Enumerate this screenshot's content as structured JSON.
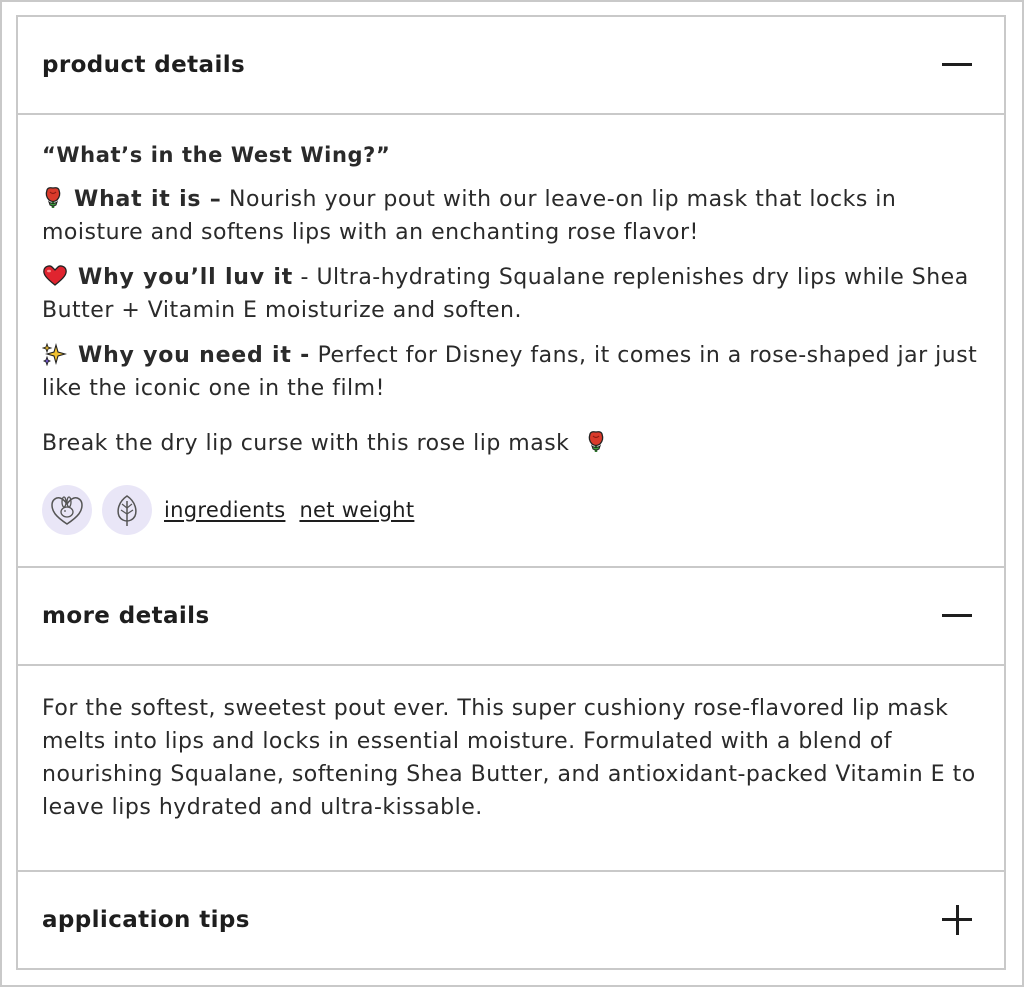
{
  "sections": [
    {
      "title": "product details",
      "expanded": true,
      "toggle_icon": "minus-icon"
    },
    {
      "title": "more details",
      "expanded": true,
      "toggle_icon": "minus-icon"
    },
    {
      "title": "application tips",
      "expanded": false,
      "toggle_icon": "plus-icon"
    }
  ],
  "product_details": {
    "quote": "“What’s in the West Wing?”",
    "what_it_is": {
      "icon": "rose-icon",
      "label": "What it is –",
      "text": " Nourish your pout with our leave-on lip mask that locks in moisture and softens lips with an enchanting rose flavor!"
    },
    "why_luv": {
      "icon": "heart-icon",
      "label": "Why you’ll luv it",
      "text": " - Ultra-hydrating Squalane replenishes dry lips while Shea Butter + Vitamin E moisturize and soften."
    },
    "why_need": {
      "icon": "sparkles-icon",
      "label": "Why you need it -",
      "text": " Perfect for Disney fans, it comes in a rose-shaped jar just like the iconic one in the film!"
    },
    "curse_line": "Break the dry lip curse with this rose lip mask",
    "badges": [
      "cruelty-free-bunny-icon",
      "vegan-leaf-icon"
    ],
    "links": {
      "ingredients": "ingredients",
      "net_weight": "net weight"
    }
  },
  "more_details": {
    "text": "For the softest, sweetest pout ever. This super cushiony rose-flavored lip mask melts into lips and locks in essential moisture. Formulated with a blend of nourishing Squalane, softening Shea Butter, and antioxidant-packed Vitamin E to leave lips hydrated and ultra-kissable."
  },
  "colors": {
    "border": "#c9c9c9",
    "text": "#2a2a2a",
    "badge_bg": "#e9e6f7",
    "rose_red": "#d93a2b",
    "heart_red": "#e0242f",
    "sparkle_yellow": "#f2c230"
  }
}
